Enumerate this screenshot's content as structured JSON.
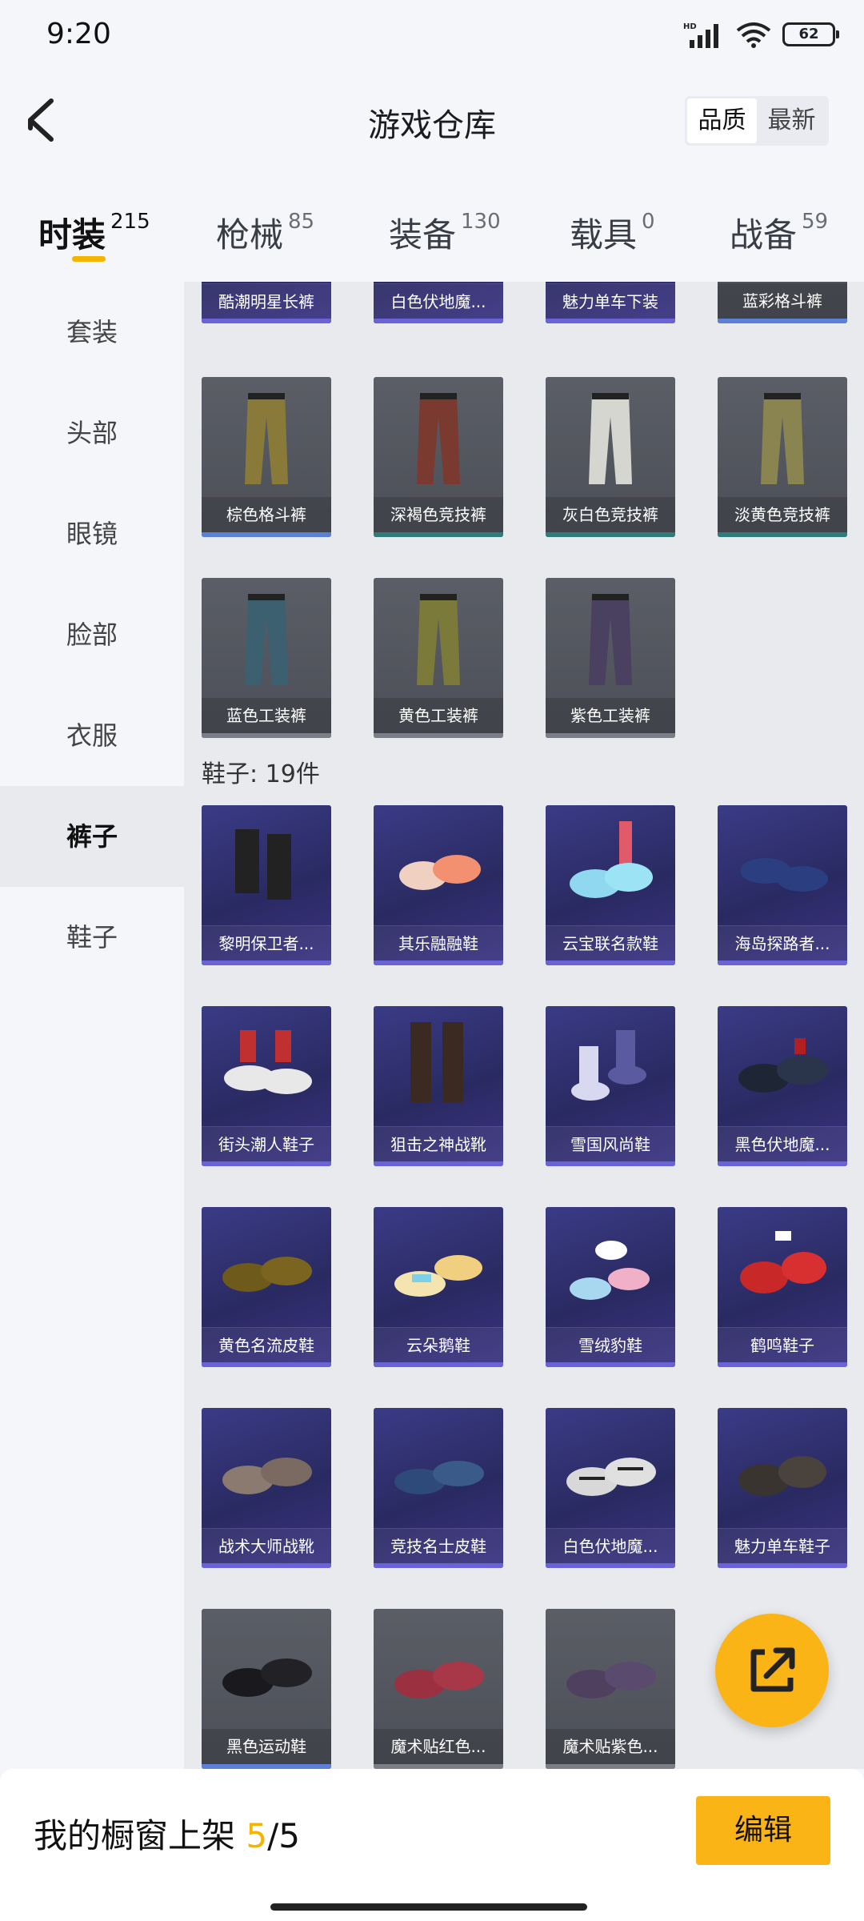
{
  "status_bar": {
    "time": "9:20",
    "battery": "62",
    "network": "HD"
  },
  "header": {
    "title": "游戏仓库",
    "sort_quality": "品质",
    "sort_newest": "最新"
  },
  "category_tabs": [
    {
      "label": "时装",
      "count": "215"
    },
    {
      "label": "枪械",
      "count": "85"
    },
    {
      "label": "装备",
      "count": "130"
    },
    {
      "label": "载具",
      "count": "0"
    },
    {
      "label": "战备",
      "count": "59"
    }
  ],
  "sidebar": [
    "套装",
    "头部",
    "眼镜",
    "脸部",
    "衣服",
    "裤子",
    "鞋子"
  ],
  "pants": [
    "酷潮明星长裤",
    "白色伏地魔...",
    "魅力单车下装",
    "蓝彩格斗裤",
    "棕色格斗裤",
    "深褐色竞技裤",
    "灰白色竞技裤",
    "淡黄色竞技裤",
    "蓝色工装裤",
    "黄色工装裤",
    "紫色工装裤"
  ],
  "shoes_header": "鞋子: 19件",
  "shoes": [
    "黎明保卫者...",
    "其乐融融鞋",
    "云宝联名款鞋",
    "海岛探路者...",
    "街头潮人鞋子",
    "狙击之神战靴",
    "雪国风尚鞋",
    "黑色伏地魔...",
    "黄色名流皮鞋",
    "云朵鹅鞋",
    "雪绒豹鞋",
    "鹤鸣鞋子",
    "战术大师战靴",
    "竞技名士皮鞋",
    "白色伏地魔...",
    "魅力单车鞋子",
    "黑色运动鞋",
    "魔术贴红色...",
    "魔术贴紫色..."
  ],
  "bottom_bar": {
    "label": "我的橱窗上架",
    "current": "5",
    "total": "/5",
    "edit": "编辑"
  },
  "colors": {
    "accent": "#fbb415",
    "rarity_purple": "#3a3b86",
    "rarity_grey": "#5b5e66"
  },
  "icons": [
    "back-arrow-icon",
    "share-icon",
    "wifi-icon",
    "signal-icon",
    "battery-icon"
  ]
}
